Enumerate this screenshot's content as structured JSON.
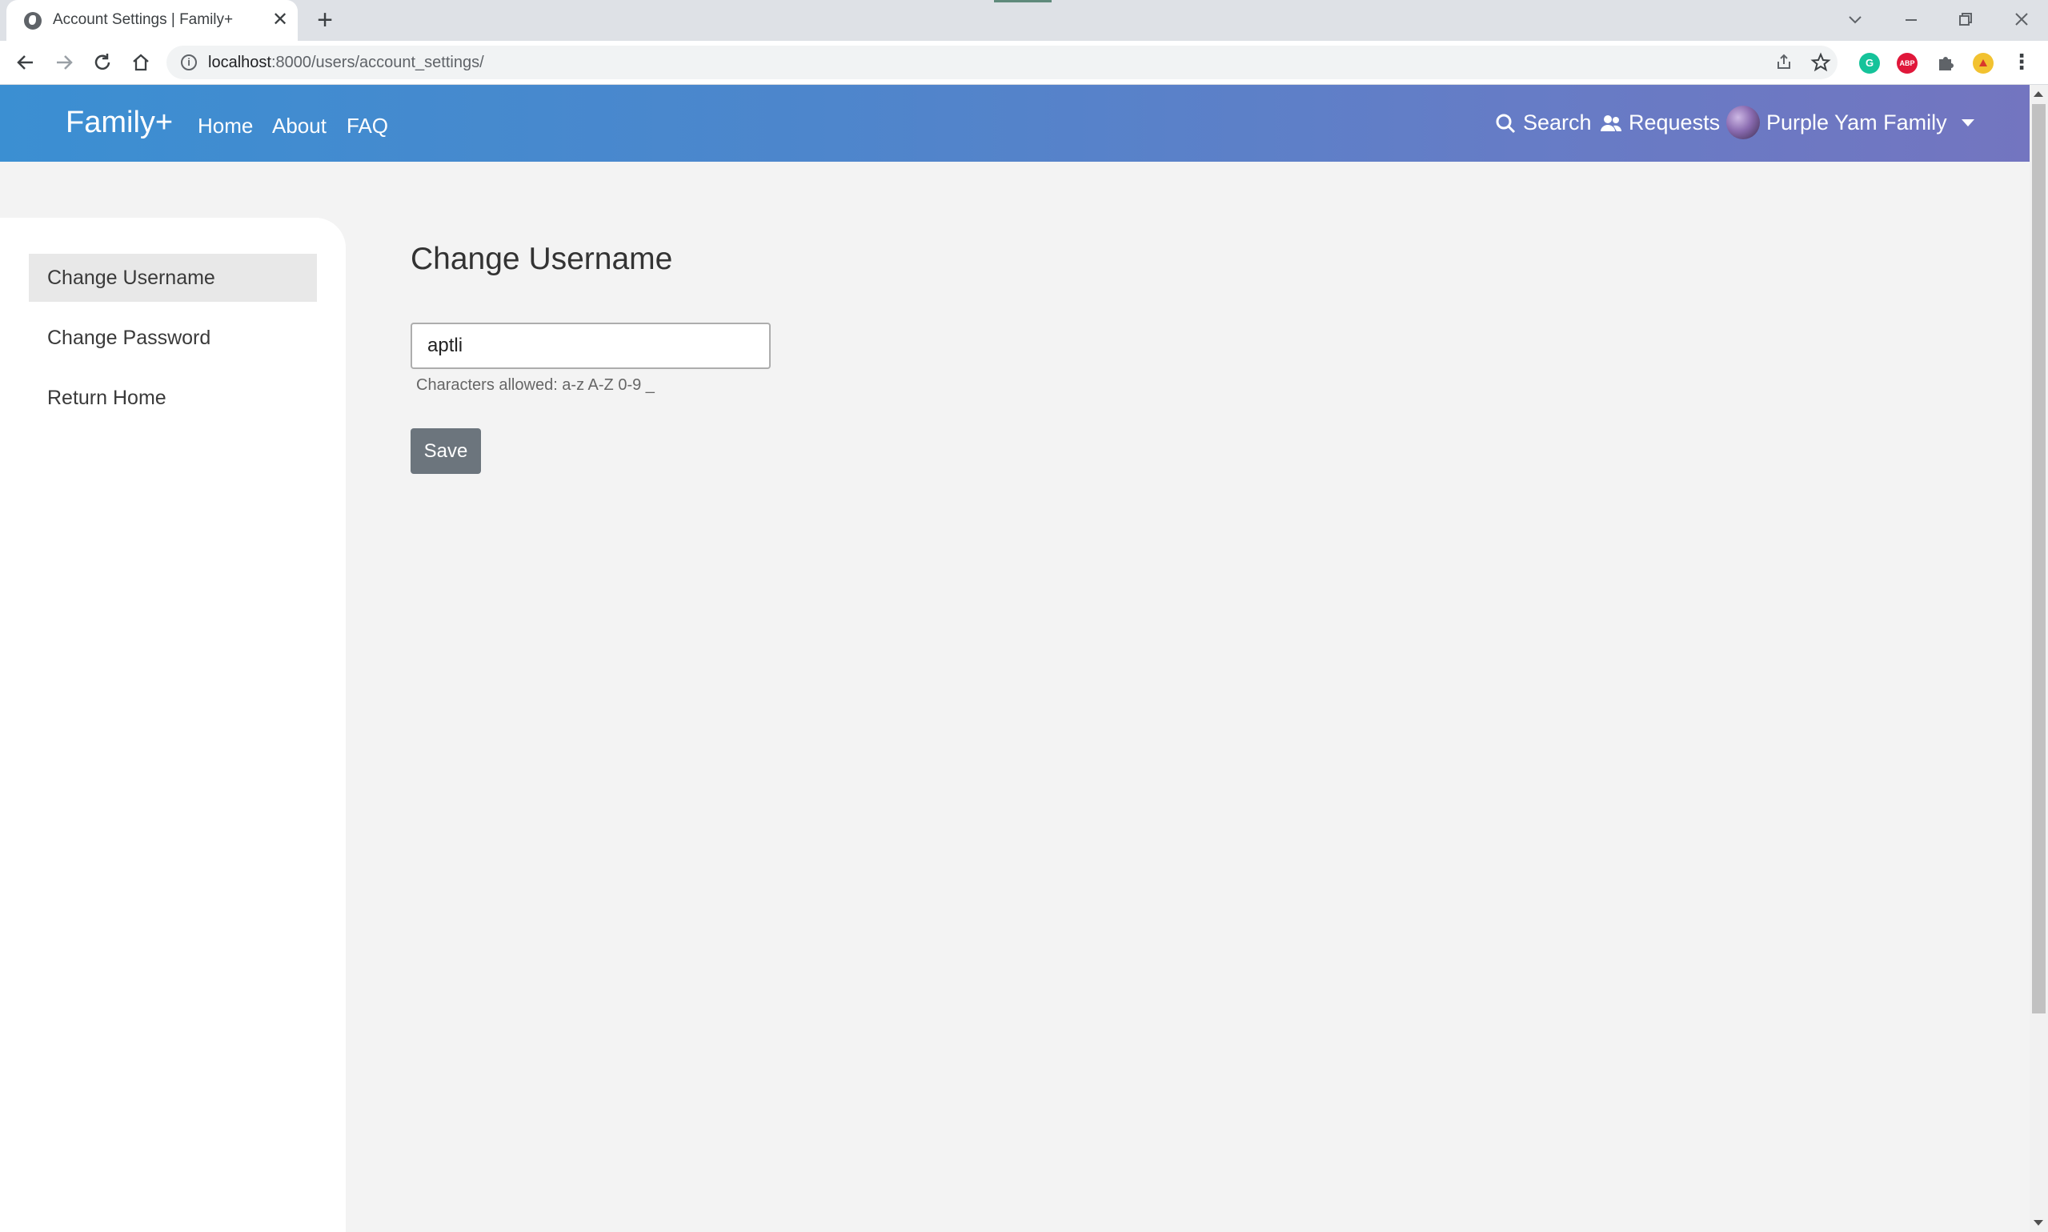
{
  "browser": {
    "tab_title": "Account Settings | Family+",
    "tab_close": "✕",
    "new_tab": "+",
    "url_host": "localhost",
    "url_rest": ":8000/users/account_settings/",
    "back_icon": "arrow-left-icon",
    "forward_icon": "arrow-right-icon",
    "reload_icon": "reload-icon",
    "home_icon": "home-icon",
    "extensions": [
      {
        "name": "grammarly",
        "label": "G",
        "color": "#15c39a"
      },
      {
        "name": "adblock-plus",
        "label": "ABP",
        "color": "#e0173a"
      },
      {
        "name": "puzzle",
        "label": "",
        "color": "#5f6368"
      },
      {
        "name": "profile",
        "label": "",
        "color": "#f2c230"
      }
    ]
  },
  "navbar": {
    "brand": "Family+",
    "links": [
      "Home",
      "About",
      "FAQ"
    ],
    "search_label": "Search",
    "requests_label": "Requests",
    "user_label": "Purple Yam Family",
    "gradient_start": "#3b8fd2",
    "gradient_end": "#7375c0"
  },
  "sidebar": {
    "items": [
      {
        "label": "Change Username",
        "active": true
      },
      {
        "label": "Change Password",
        "active": false
      },
      {
        "label": "Return Home",
        "active": false
      }
    ]
  },
  "main": {
    "title": "Change Username",
    "username_value": "aptli",
    "help_text": "Characters allowed: a-z A-Z 0-9 _",
    "save_label": "Save",
    "save_color": "#6c757d"
  }
}
